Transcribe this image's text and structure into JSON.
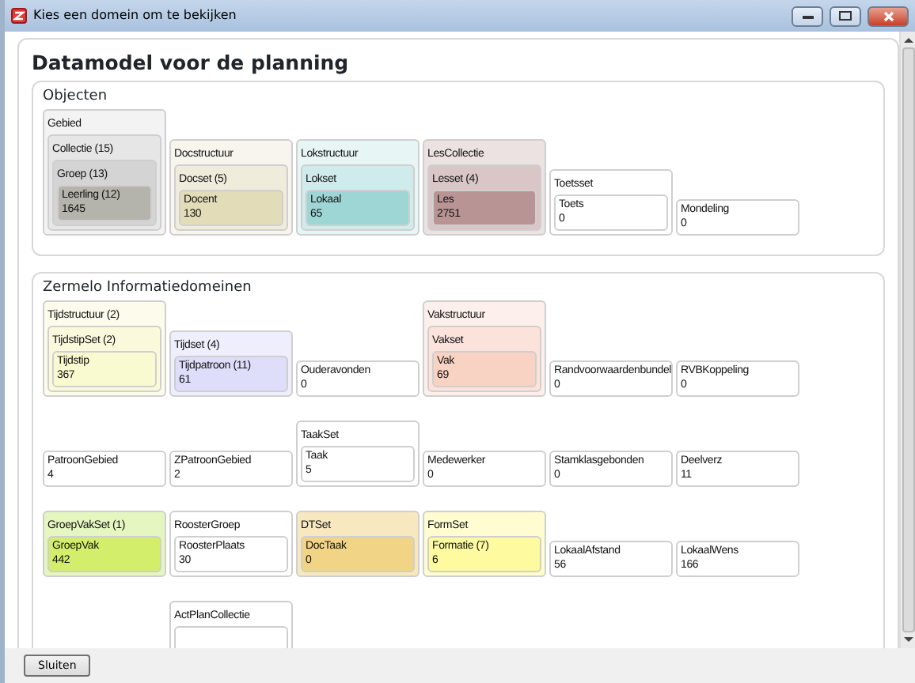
{
  "window": {
    "title": "Kies een domein om te bekijken"
  },
  "heading": "Datamodel voor de planning",
  "sections": [
    {
      "title": "Objecten",
      "rows": [
        [
          {
            "label": "Gebied",
            "color": "#f3f3f3",
            "child": {
              "label": "Collectie (15)",
              "color": "#e6e6e6",
              "child": {
                "label": "Groep (13)",
                "color": "#d4d4d4",
                "child": {
                  "label": "Leerling (12)",
                  "count": "1645",
                  "color": "#b4b4ac"
                }
              }
            }
          },
          {
            "label": "Docstructuur",
            "color": "#f7f5ee",
            "child": {
              "label": "Docset (5)",
              "color": "#efecdc",
              "child": {
                "label": "Docent",
                "count": "130",
                "color": "#e2ddb8"
              }
            }
          },
          {
            "label": "Lokstructuur",
            "color": "#e8f5f5",
            "child": {
              "label": "Lokset",
              "color": "#d0ebeb",
              "child": {
                "label": "Lokaal",
                "count": "65",
                "color": "#9ed6d6"
              }
            }
          },
          {
            "label": "LesCollectie",
            "color": "#ede2e2",
            "child": {
              "label": "Lesset (4)",
              "color": "#dac6c6",
              "child": {
                "label": "Les",
                "count": "2751",
                "color": "#b99494"
              }
            }
          },
          {
            "label": "Toetsset",
            "color": "#ffffff",
            "child": {
              "label": "Toets",
              "count": "0",
              "color": "#ffffff"
            }
          },
          {
            "label": "Mondeling",
            "count": "0",
            "color": "#ffffff"
          }
        ]
      ]
    },
    {
      "title": "Zermelo Informatiedomeinen",
      "rows": [
        [
          {
            "label": "Tijdstructuur (2)",
            "color": "#fdfcec",
            "child": {
              "label": "TijdstipSet (2)",
              "color": "#fbf9dc",
              "child": {
                "label": "Tijdstip",
                "count": "367",
                "color": "#fafad0"
              }
            }
          },
          {
            "label": "Tijdset (4)",
            "color": "#eeeefc",
            "child": {
              "label": "Tijdpatroon (11)",
              "count": "61",
              "color": "#dedefa"
            }
          },
          {
            "label": "Ouderavonden",
            "count": "0",
            "color": "#ffffff"
          },
          {
            "label": "Vakstructuur",
            "color": "#fdf0ec",
            "child": {
              "label": "Vakset",
              "color": "#fbe2da",
              "child": {
                "label": "Vak",
                "count": "69",
                "color": "#f8d2c2"
              }
            }
          },
          {
            "label": "Randvoorwaardenbundel",
            "count": "0",
            "color": "#ffffff"
          },
          {
            "label": "RVBKoppeling",
            "count": "0",
            "color": "#ffffff"
          }
        ],
        [
          {
            "label": "PatroonGebied",
            "count": "4",
            "color": "#ffffff"
          },
          {
            "label": "ZPatroonGebied",
            "count": "2",
            "color": "#ffffff"
          },
          {
            "label": "TaakSet",
            "color": "#ffffff",
            "child": {
              "label": "Taak",
              "count": "5",
              "color": "#ffffff"
            }
          },
          {
            "label": "Medewerker",
            "count": "0",
            "color": "#ffffff"
          },
          {
            "label": "Stamklasgebonden",
            "count": "0",
            "color": "#ffffff"
          },
          {
            "label": "Deelverz",
            "count": "11",
            "color": "#ffffff"
          }
        ],
        [
          {
            "label": "GroepVakSet (1)",
            "color": "#e6f6c0",
            "child": {
              "label": "GroepVak",
              "count": "442",
              "color": "#d2ee6a"
            }
          },
          {
            "label": "RoosterGroep",
            "color": "#ffffff",
            "child": {
              "label": "RoosterPlaats",
              "count": "30",
              "color": "#ffffff"
            }
          },
          {
            "label": "DTSet",
            "color": "#f8e8c0",
            "child": {
              "label": "DocTaak",
              "count": "0",
              "color": "#f2d486"
            }
          },
          {
            "label": "FormSet",
            "color": "#fefcd0",
            "child": {
              "label": "Formatie (7)",
              "count": "6",
              "color": "#fdfaa0"
            }
          },
          {
            "label": "LokaalAfstand",
            "count": "56",
            "color": "#ffffff"
          },
          {
            "label": "LokaalWens",
            "count": "166",
            "color": "#ffffff"
          }
        ],
        [
          {
            "kind": "gap"
          },
          {
            "label": "ActPlanCollectie",
            "color": "#ffffff",
            "child": {
              "color": "#ffffff"
            }
          }
        ]
      ]
    }
  ],
  "close_button": "Sluiten"
}
